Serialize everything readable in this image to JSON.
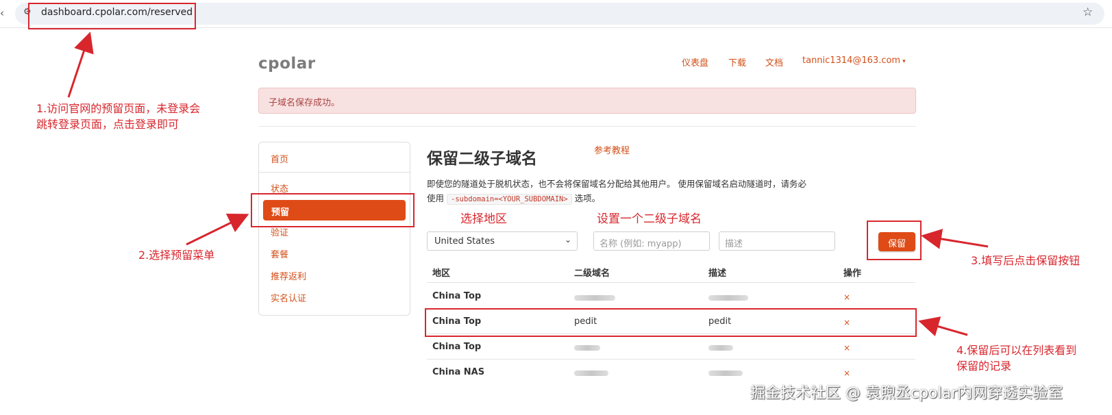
{
  "browser": {
    "url": "dashboard.cpolar.com/reserved"
  },
  "site": {
    "logo": "cpolar",
    "nav": [
      "仪表盘",
      "下载",
      "文档"
    ],
    "user": "tannic1314@163.com"
  },
  "alert": "子域名保存成功。",
  "sidebar": {
    "items": [
      "首页",
      "状态",
      "预留",
      "验证",
      "套餐",
      "推荐返利",
      "实名认证"
    ],
    "active": "预留"
  },
  "main": {
    "title": "保留二级子域名",
    "ref_link": "参考教程",
    "desc_before": "即使您的隧道处于脱机状态，也不会将保留域名分配给其他用户。 使用保留域名启动隧道时，请务必使用",
    "desc_code": "-subdomain=<YOUR_SUBDOMAIN>",
    "desc_after": "选项。",
    "region_select": "United States",
    "subdomain_placeholder": "名称 (例如: myapp)",
    "description_placeholder": "描述",
    "save_label": "保留"
  },
  "table": {
    "headers": [
      "地区",
      "二级域名",
      "描述",
      "操作"
    ],
    "rows": [
      {
        "region": "China Top",
        "subdomain": "",
        "description": "",
        "action": "×"
      },
      {
        "region": "China Top",
        "subdomain": "pedit",
        "description": "pedit",
        "action": "×"
      },
      {
        "region": "China Top",
        "subdomain": "",
        "description": "",
        "action": "×"
      },
      {
        "region": "China NAS",
        "subdomain": "",
        "description": "",
        "action": "×"
      }
    ]
  },
  "annotations": {
    "step1_line1": "1.访问官网的预留页面，未登录会",
    "step1_line2": "跳转登录页面，点击登录即可",
    "step2": "2.选择预留菜单",
    "label_region": "选择地区",
    "label_subdomain": "设置一个二级子域名",
    "step3": "3.填写后点击保留按钮",
    "step4_line1": "4.保留后可以在列表看到",
    "step4_line2": "保留的记录",
    "color": "#d8262d"
  },
  "watermark": "掘金技术社区 @ 袁煦丞cpolar内网穿透实验室"
}
